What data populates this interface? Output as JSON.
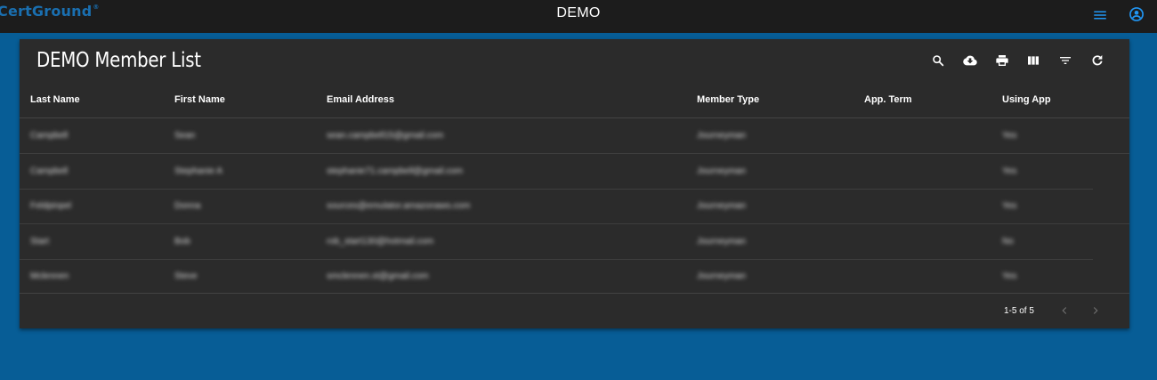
{
  "header": {
    "brand": "CertGround",
    "brand_mark": "®",
    "title": "DEMO",
    "menu_icon": "menu-icon",
    "account_icon": "account-circle-icon",
    "brand_color": "#1a6fb0"
  },
  "table": {
    "title": "DEMO Member List",
    "toolbar": [
      "search-icon",
      "download-icon",
      "print-icon",
      "view-columns-icon",
      "filter-icon",
      "refresh-icon"
    ],
    "columns": [
      "Last Name",
      "First Name",
      "Email Address",
      "Member Type",
      "App. Term",
      "Using App"
    ],
    "rows": [
      [
        "Campbell",
        "Sean",
        "sean.campbell15@gmail.com",
        "Journeyman",
        "",
        "Yes"
      ],
      [
        "Campbell",
        "Stephanie A",
        "stephanie71.campbell@gmail.com",
        "Journeyman",
        "",
        "Yes"
      ],
      [
        "Feldpinpel",
        "Donna",
        "sources@emulator.amazonaws.com",
        "Journeyman",
        "",
        "Yes"
      ],
      [
        "Start",
        "Bob",
        "rob_start130@hotmail.com",
        "Journeyman",
        "",
        "No"
      ],
      [
        "Mclennen",
        "Steve",
        "smclennen.st@gmail.com",
        "Journeyman",
        "",
        "Yes"
      ]
    ]
  },
  "pagination": {
    "range": "1-5 of 5",
    "prev_icon": "chevron-left-icon",
    "next_icon": "chevron-right-icon"
  },
  "colors": {
    "page_background": "#075d96",
    "topbar": "#1c1c1c",
    "card": "#2b2b2b",
    "accent_icons": "#2196f3"
  }
}
